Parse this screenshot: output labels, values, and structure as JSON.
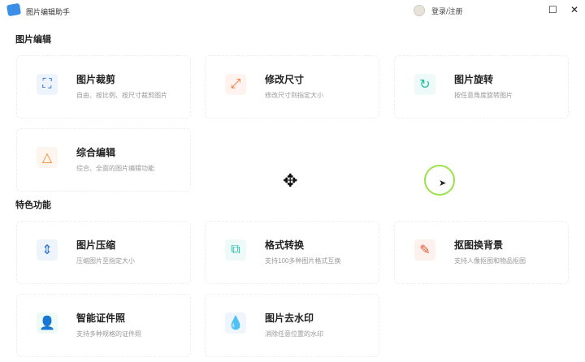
{
  "app": {
    "title": "图片编辑助手",
    "login": "登录/注册"
  },
  "sections": [
    {
      "title": "图片编辑",
      "cards": [
        {
          "title": "图片裁剪",
          "sub": "自由、按比例、按尺寸裁剪图片",
          "icon": "crop-icon",
          "color": "#2a6fdb"
        },
        {
          "title": "修改尺寸",
          "sub": "修改尺寸到指定大小",
          "icon": "resize-icon",
          "color": "#f06a2a"
        },
        {
          "title": "图片旋转",
          "sub": "按任意角度旋转图片",
          "icon": "rotate-icon",
          "color": "#1fbfa6"
        },
        {
          "title": "综合编辑",
          "sub": "综合、全面的图片编辑功能",
          "icon": "shapes-icon",
          "color": "#f08a2a"
        }
      ]
    },
    {
      "title": "特色功能",
      "cards": [
        {
          "title": "图片压缩",
          "sub": "压缩图片至指定大小",
          "icon": "compress-icon",
          "color": "#2a6fdb"
        },
        {
          "title": "格式转换",
          "sub": "支持100多种图片格式互换",
          "icon": "convert-icon",
          "color": "#1fbfa6"
        },
        {
          "title": "抠图换背景",
          "sub": "支持人像抠图和物品抠图",
          "icon": "cutout-icon",
          "color": "#e8502a"
        },
        {
          "title": "智能证件照",
          "sub": "支持多种规格的证件照",
          "icon": "id-photo-icon",
          "color": "#1fbf8a"
        },
        {
          "title": "图片去水印",
          "sub": "消除任意位置的水印",
          "icon": "watermark-remove-icon",
          "color": "#2a7fe8"
        }
      ]
    }
  ]
}
